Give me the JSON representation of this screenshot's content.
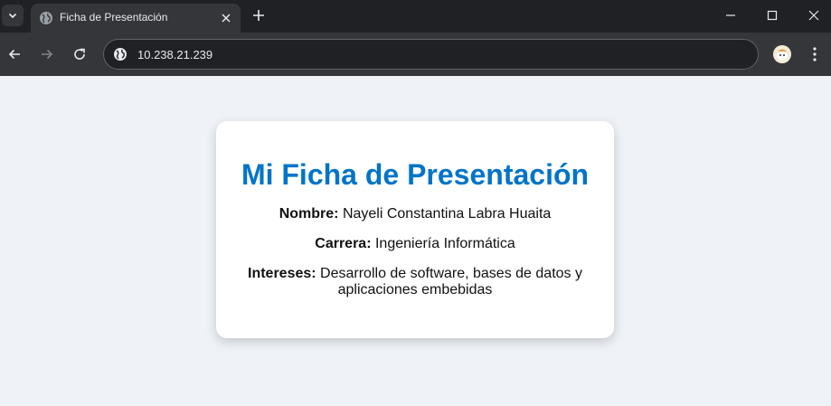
{
  "browser": {
    "tab_title": "Ficha de Presentación",
    "url": "10.238.21.239"
  },
  "card": {
    "title": "Mi Ficha de Presentación",
    "fields": [
      {
        "label": "Nombre:",
        "value": "Nayeli Constantina Labra Huaita"
      },
      {
        "label": "Carrera:",
        "value": "Ingeniería Informática"
      },
      {
        "label": "Intereses:",
        "value": "Desarrollo de software, bases de datos y aplicaciones embebidas"
      }
    ]
  },
  "colors": {
    "title": "#0074c8",
    "page_background": "#eff2f7",
    "card_background": "#ffffff",
    "tabstrip": "#202124",
    "toolbar": "#35363a"
  },
  "icons": [
    "tab-search-icon",
    "globe-icon",
    "close-icon",
    "plus-icon",
    "minimize-icon",
    "maximize-icon",
    "window-close-icon",
    "back-arrow-icon",
    "forward-arrow-icon",
    "reload-icon",
    "site-info-icon",
    "profile-avatar-icon",
    "more-menu-icon"
  ]
}
